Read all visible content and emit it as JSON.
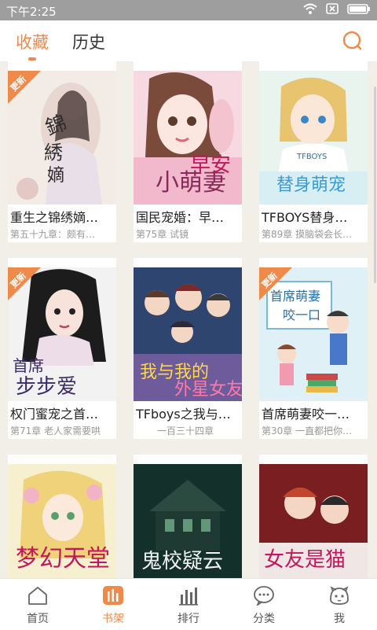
{
  "statusbar": {
    "time": "下午2:25"
  },
  "header": {
    "tabs": [
      {
        "label": "收藏",
        "active": true
      },
      {
        "label": "历史",
        "active": false
      }
    ]
  },
  "books": [
    {
      "title": "重生之锦绣嫡…",
      "subtitle": "第五十九章：颇有…",
      "updated": true,
      "badge": "更新"
    },
    {
      "title": "国民宠婚：早…",
      "subtitle": "第75章 试镜",
      "updated": false
    },
    {
      "title": "TFBOYS替身…",
      "subtitle": "第89章 摸脑袋会长…",
      "updated": false
    },
    {
      "title": "权门蜜宠之首…",
      "subtitle": "第71章 老人家需要哄",
      "updated": true,
      "badge": "更新"
    },
    {
      "title": "TFboys之我与…",
      "subtitle": "一百三十四章",
      "updated": false
    },
    {
      "title": "首席萌妻咬一…",
      "subtitle": "第30章 一直都把你…",
      "updated": true,
      "badge": "更新"
    },
    {
      "title": "",
      "subtitle": "",
      "updated": false
    },
    {
      "title": "",
      "subtitle": "",
      "updated": false
    },
    {
      "title": "",
      "subtitle": "",
      "updated": false
    }
  ],
  "nav": [
    {
      "label": "首页",
      "icon": "home-icon",
      "active": false
    },
    {
      "label": "书架",
      "icon": "bookshelf-icon",
      "active": true
    },
    {
      "label": "排行",
      "icon": "ranking-icon",
      "active": false
    },
    {
      "label": "分类",
      "icon": "category-icon",
      "active": false
    },
    {
      "label": "我",
      "icon": "profile-icon",
      "active": false
    }
  ],
  "colors": {
    "accent": "#f08a4b",
    "statusbar": "#9e9e9e"
  }
}
